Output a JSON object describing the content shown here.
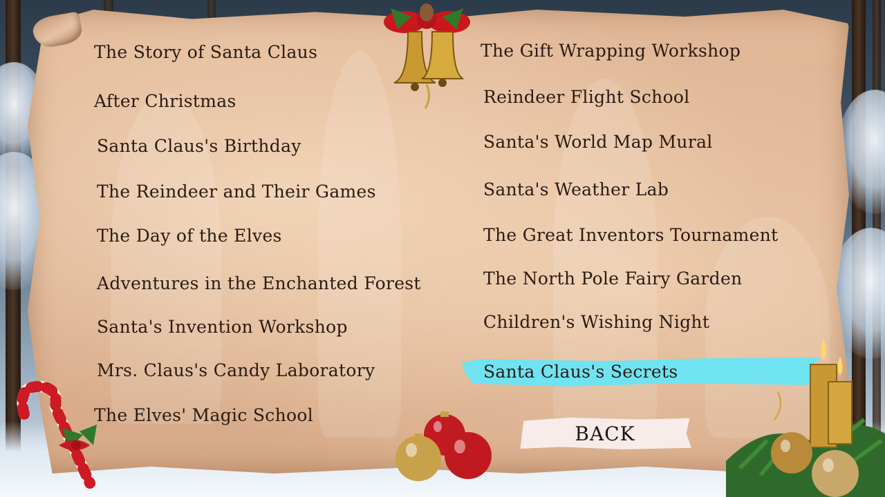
{
  "menu": {
    "left": [
      "The Story of Santa Claus",
      "After Christmas",
      "Santa Claus's Birthday",
      "The Reindeer and Their Games",
      "The Day of the Elves",
      "Adventures in the Enchanted Forest",
      "Santa's Invention Workshop",
      "Mrs. Claus's Candy Laboratory",
      "The Elves' Magic School"
    ],
    "right": [
      "The Gift Wrapping Workshop",
      "Reindeer Flight School",
      "Santa's World Map Mural",
      "Santa's Weather Lab",
      "The Great Inventors Tournament",
      "The North Pole Fairy Garden",
      "Children's Wishing Night",
      "Santa Claus's Secrets"
    ],
    "selected": "Santa Claus's Secrets"
  },
  "back_label": "BACK",
  "colors": {
    "parchment": "#dcb291",
    "text": "#2a1b12",
    "highlight": "#6fe3f2",
    "back_button": "#f7ecea"
  },
  "icons": [
    "bells-icon",
    "candy-cane-icon",
    "ornaments-icon",
    "candles-icon"
  ]
}
